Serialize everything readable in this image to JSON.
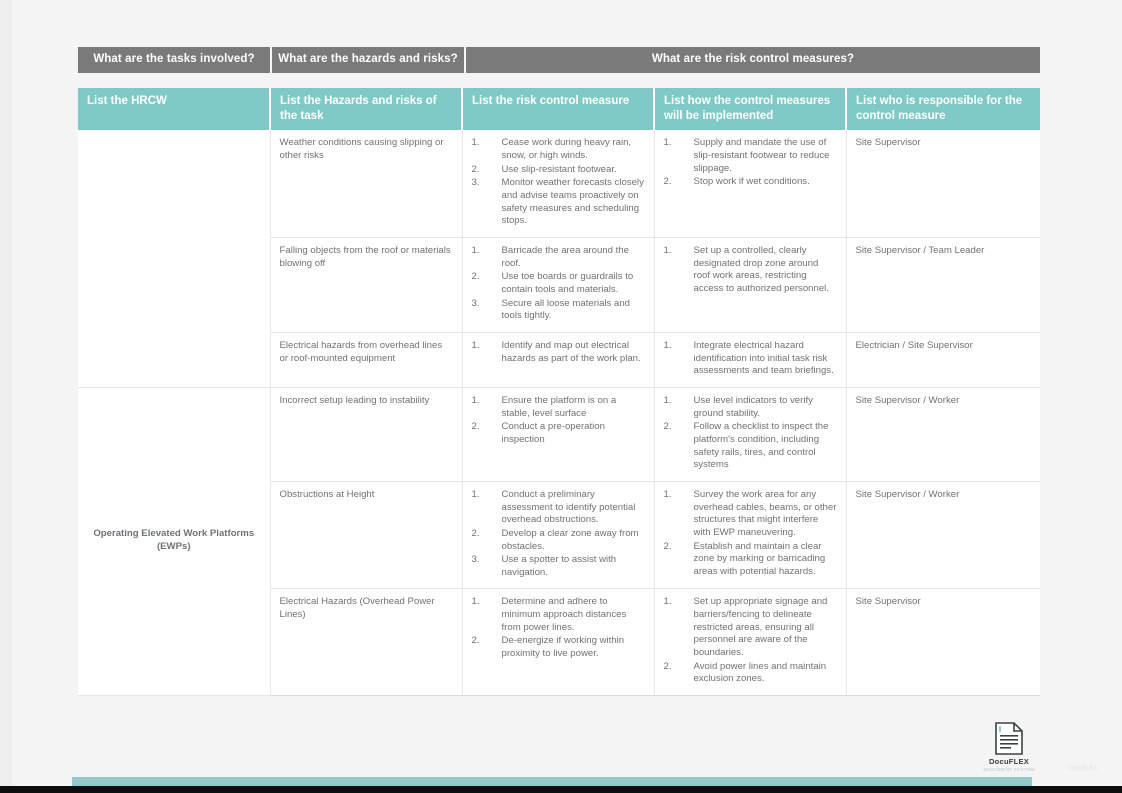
{
  "banner": {
    "groups": [
      {
        "label": "What are the tasks involved?"
      },
      {
        "label": "What are the hazards and risks?"
      },
      {
        "label": "What are the risk control measures?"
      }
    ]
  },
  "table": {
    "headers": [
      "List the HRCW",
      "List the Hazards and risks of the task",
      "List the risk control measure",
      "List how the control measures will be implemented",
      "List who is responsible for the control measure"
    ],
    "groups": [
      {
        "hrcw": "",
        "rows": [
          {
            "hazard": "Weather conditions causing slipping or other risks",
            "controls": [
              "Cease work during heavy rain, snow, or high winds.",
              "Use slip-resistant footwear.",
              "Monitor weather forecasts closely and advise teams proactively on safety measures and scheduling stops."
            ],
            "implementation": [
              "Supply and mandate the use of slip-resistant footwear to reduce slippage.",
              "Stop work if wet conditions."
            ],
            "responsible": "Site Supervisor"
          },
          {
            "hazard": "Falling objects from the roof or materials blowing off",
            "controls": [
              "Barricade the area around the roof.",
              "Use toe boards or guardrails to contain tools and materials.",
              "Secure all loose materials and tools tightly."
            ],
            "implementation": [
              "Set up a controlled, clearly designated drop zone around roof work areas, restricting access to authorized personnel."
            ],
            "responsible": "Site Supervisor / Team Leader"
          },
          {
            "hazard": "Electrical hazards from overhead lines or roof-mounted equipment",
            "controls": [
              "Identify and map out electrical hazards as part of the work plan."
            ],
            "implementation": [
              "Integrate electrical hazard identification into initial task risk assessments and team briefings."
            ],
            "responsible": "Electrician / Site Supervisor"
          }
        ]
      },
      {
        "hrcw": "Operating Elevated Work Platforms (EWPs)",
        "rows": [
          {
            "hazard": "Incorrect setup leading to instability",
            "controls": [
              "Ensure the platform is on a stable, level surface",
              "Conduct a pre-operation inspection"
            ],
            "implementation": [
              "Use level indicators to verify ground stability.",
              "Follow a checklist to inspect the platform's condition, including safety rails, tires, and control systems"
            ],
            "responsible": "Site Supervisor / Worker"
          },
          {
            "hazard": "Obstructions at Height",
            "controls": [
              "Conduct a preliminary assessment to identify potential overhead obstructions.",
              "Develop a clear zone away from obstacles.",
              "Use a spotter to assist with navigation."
            ],
            "implementation": [
              "Survey the work area for any overhead cables, beams, or other structures that might interfere with EWP maneuvering.",
              "Establish and maintain a clear zone by marking or barricading areas with potential hazards."
            ],
            "responsible": "Site Supervisor / Worker"
          },
          {
            "hazard": "Electrical Hazards (Overhead Power Lines)",
            "controls": [
              "Determine and adhere to minimum approach distances from power lines.",
              "De-energize if working within proximity to live power."
            ],
            "implementation": [
              "Set up appropriate signage and barriers/fencing to delineate restricted areas, ensuring all personnel are aware of the boundaries.",
              "Avoid power lines and maintain exclusion zones."
            ],
            "responsible": "Site Supervisor"
          }
        ]
      }
    ]
  },
  "footer": {
    "logo_brand": "DocuFLEX",
    "logo_sub": "DOCUMENT SYSTEM",
    "faint_note": "DocuFLEX"
  },
  "colors": {
    "banner_gray": "#7a7a7a",
    "header_teal": "#7fc9c6",
    "bottom_bar_teal": "#93c9c8",
    "body_text": "#6f7377",
    "page_bg": "#f2f2f2"
  }
}
